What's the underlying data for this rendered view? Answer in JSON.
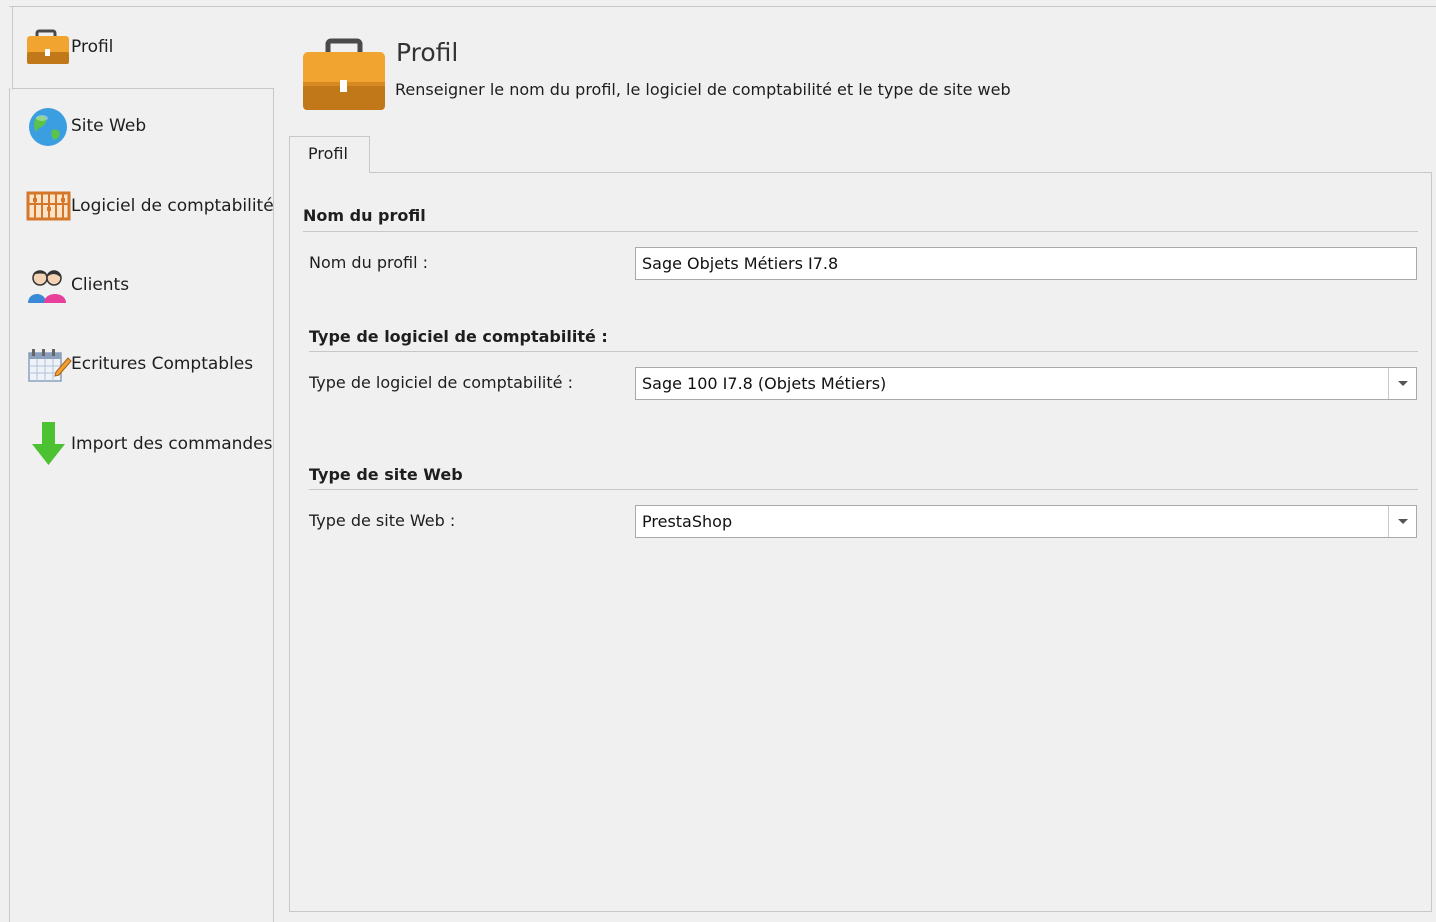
{
  "nav": {
    "items": [
      {
        "label": "Profil",
        "icon": "briefcase-icon"
      },
      {
        "label": "Site Web",
        "icon": "globe-icon"
      },
      {
        "label": "Logiciel de comptabilité",
        "icon": "abacus-icon"
      },
      {
        "label": "Clients",
        "icon": "users-icon"
      },
      {
        "label": "Ecritures Comptables",
        "icon": "calendar-edit-icon"
      },
      {
        "label": "Import des commandes",
        "icon": "arrow-down-icon"
      }
    ],
    "selected": "Profil"
  },
  "header": {
    "title": "Profil",
    "subtitle": "Renseigner le nom du profil, le logiciel de comptabilité et le type de site web",
    "icon": "briefcase-icon"
  },
  "tab": {
    "label": "Profil"
  },
  "form": {
    "section_profile": {
      "title": "Nom du profil",
      "field_label": "Nom du profil :",
      "value": "Sage Objets Métiers I7.8"
    },
    "section_accounting": {
      "title": "Type de logiciel de comptabilité :",
      "field_label": "Type de logiciel de comptabilité :",
      "value": "Sage 100 I7.8 (Objets Métiers)"
    },
    "section_website": {
      "title": "Type de site Web",
      "field_label": "Type de site Web :",
      "value": "PrestaShop"
    }
  },
  "colors": {
    "briefcase": "#f0a030",
    "globe": "#3aa0e0",
    "arrow": "#4cc233",
    "border": "#c8c8c8",
    "background": "#f0f0f0"
  }
}
